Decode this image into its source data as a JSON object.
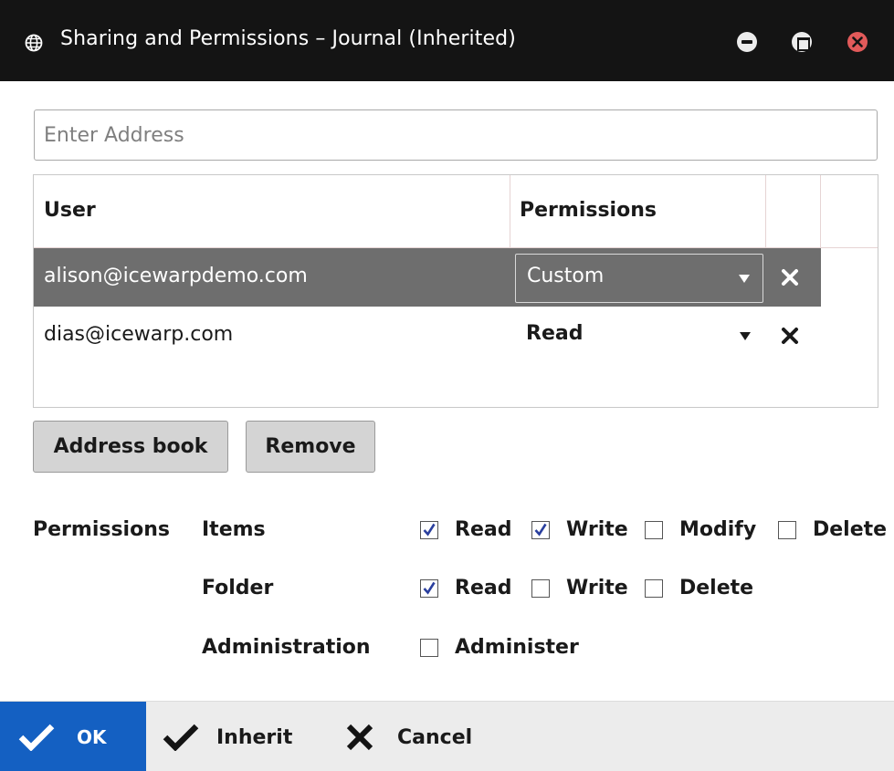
{
  "window": {
    "title": "Sharing and Permissions – Journal (Inherited)",
    "icon": "globe-icon"
  },
  "address": {
    "placeholder": "Enter Address",
    "value": ""
  },
  "grid": {
    "columns": [
      "User",
      "Permissions"
    ],
    "rows": [
      {
        "email": "alison@icewarpdemo.com",
        "permission": "Custom",
        "selected": true
      },
      {
        "email": "dias@icewarp.com",
        "permission": "Read",
        "selected": false
      }
    ]
  },
  "buttons": {
    "address_book": "Address book",
    "remove": "Remove"
  },
  "permissions": {
    "label": "Permissions",
    "items": {
      "label": "Items",
      "options": [
        {
          "label": "Read",
          "checked": true
        },
        {
          "label": "Write",
          "checked": true
        },
        {
          "label": "Modify",
          "checked": false
        },
        {
          "label": "Delete",
          "checked": false
        }
      ]
    },
    "folder": {
      "label": "Folder",
      "options": [
        {
          "label": "Read",
          "checked": true
        },
        {
          "label": "Write",
          "checked": false
        },
        {
          "label": "Delete",
          "checked": false
        }
      ]
    },
    "administration": {
      "label": "Administration",
      "options": [
        {
          "label": "Administer",
          "checked": false
        }
      ]
    }
  },
  "footer": {
    "ok": "OK",
    "inherit": "Inherit",
    "cancel": "Cancel"
  },
  "colors": {
    "titlebar": "#141414",
    "selected_row": "#6e6e6e",
    "ok_button": "#1460c2",
    "close_button": "#e25a5a",
    "checkmark": "#2a3f9e"
  }
}
